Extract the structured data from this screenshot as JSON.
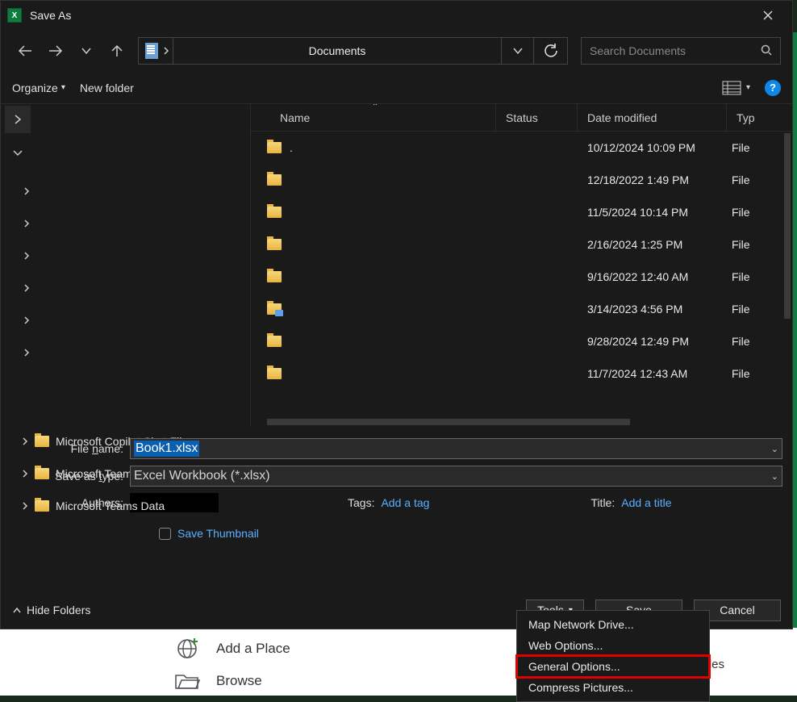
{
  "window": {
    "title": "Save As"
  },
  "nav": {
    "path_label": "Documents",
    "search_placeholder": "Search Documents"
  },
  "toolbar": {
    "organize": "Organize",
    "new_folder": "New folder"
  },
  "columns": {
    "name": "Name",
    "status": "Status",
    "date_modified": "Date modified",
    "type": "Typ"
  },
  "tree": {
    "items": [
      {
        "label": "Microsoft Copilot Chat Files"
      },
      {
        "label": "Microsoft Teams Chat Files"
      },
      {
        "label": "Microsoft Teams Data"
      }
    ]
  },
  "files": [
    {
      "name": ".",
      "date": "10/12/2024 10:09 PM",
      "type": "File"
    },
    {
      "name": "",
      "date": "12/18/2022 1:49 PM",
      "type": "File"
    },
    {
      "name": "",
      "date": "11/5/2024 10:14 PM",
      "type": "File"
    },
    {
      "name": "",
      "date": "2/16/2024 1:25 PM",
      "type": "File"
    },
    {
      "name": "",
      "date": "9/16/2022 12:40 AM",
      "type": "File"
    },
    {
      "name": "",
      "date": "3/14/2023 4:56 PM",
      "type": "File",
      "special": true
    },
    {
      "name": "",
      "date": "9/28/2024 12:49 PM",
      "type": "File"
    },
    {
      "name": "",
      "date": "11/7/2024 12:43 AM",
      "type": "File"
    }
  ],
  "form": {
    "file_name_label": "File name:",
    "file_name_value": "Book1.xlsx",
    "save_type_label": "Save as type:",
    "save_type_value": "Excel Workbook (*.xlsx)",
    "authors_label": "Authors:",
    "tags_label": "Tags:",
    "tags_link": "Add a tag",
    "title_label": "Title:",
    "title_link": "Add a title",
    "save_thumbnail": "Save Thumbnail"
  },
  "buttons": {
    "hide_folders": "Hide Folders",
    "tools": "Tools",
    "save": "Save",
    "cancel": "Cancel"
  },
  "tools_menu": {
    "map_drive": "Map Network Drive...",
    "web_options": "Web Options...",
    "general_options": "General Options...",
    "compress_pictures": "Compress Pictures..."
  },
  "background": {
    "add_place": "Add a Place",
    "browse": "Browse",
    "files_text": "files"
  }
}
